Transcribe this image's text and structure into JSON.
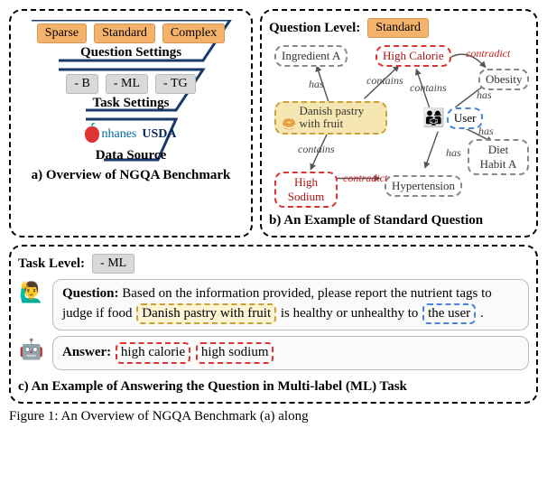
{
  "panelA": {
    "heading_q": "Question Settings",
    "heading_t": "Task Settings",
    "heading_d": "Data Source",
    "q_tags": [
      "Sparse",
      "Standard",
      "Complex"
    ],
    "t_tags": [
      "- B",
      "- ML",
      "- TG"
    ],
    "nhanes": "nhanes",
    "usda": "USDA",
    "caption": "a) Overview of NGQA Benchmark"
  },
  "panelB": {
    "title_label": "Question Level:",
    "title_tag": "Standard",
    "nodes": {
      "ingredientA": "Ingredient A",
      "highCalorie": "High Calorie",
      "obesity": "Obesity",
      "danish": "Danish pastry with fruit",
      "user": "User",
      "dietHabit": "Diet Habit A",
      "highSodium": "High Sodium",
      "hypertension": "Hypertension"
    },
    "edges": {
      "has": "has",
      "contains": "contains",
      "contradict": "contradict"
    },
    "caption": "b) An Example of Standard Question"
  },
  "panelC": {
    "title_label": "Task Level:",
    "title_tag": "- ML",
    "question_label": "Question:",
    "question_text_1": " Based on the information provided, please report the nutrient tags to judge if food ",
    "question_food": "Danish pastry with fruit",
    "question_text_2": " is healthy or unhealthy to ",
    "question_user": "the user",
    "question_tail": ".",
    "answer_label": "Answer:",
    "answer_tags": [
      "high calorie",
      "high sodium"
    ],
    "caption": "c) An Example of Answering the Question in Multi-label (ML) Task"
  },
  "figure_caption": "Figure 1: An Overview of NGQA Benchmark (a) along"
}
